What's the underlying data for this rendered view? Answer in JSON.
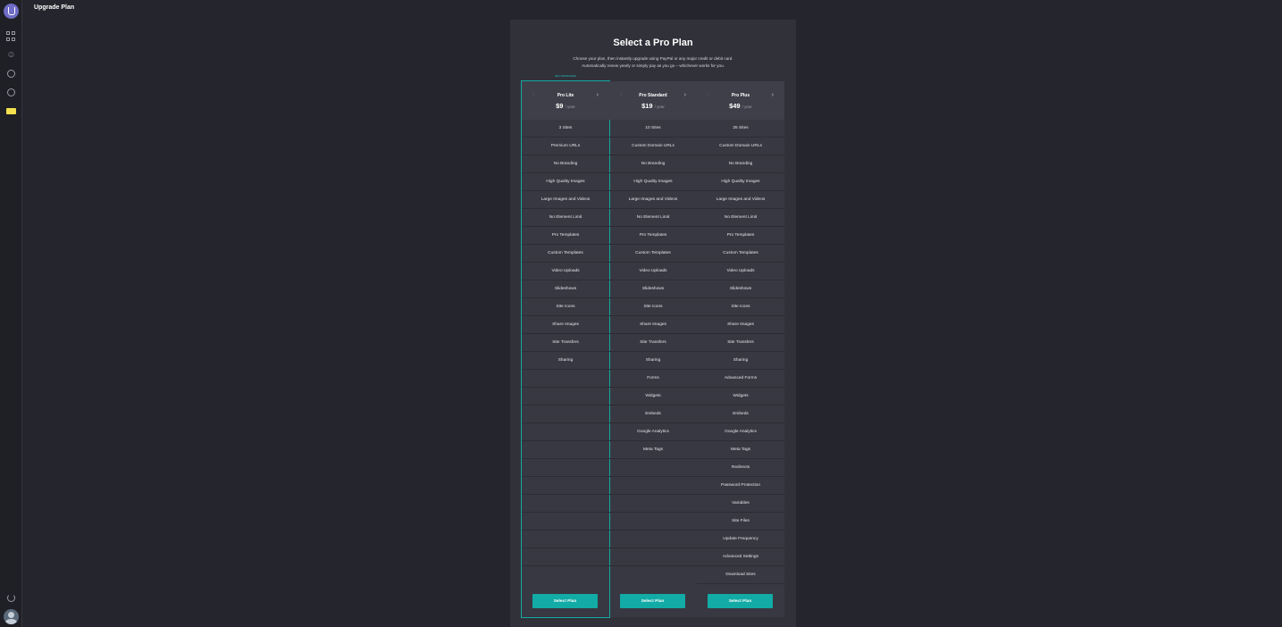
{
  "page": {
    "title": "Upgrade Plan"
  },
  "panel": {
    "title": "Select a Pro Plan",
    "subtitle_1": "Choose your plan, then instantly upgrade using PayPal or any major credit or debit card.",
    "subtitle_2": "Automatically renew yearly or simply pay as you go – whichever works for you.",
    "highlight_note": "RECOMMENDED"
  },
  "plans": [
    {
      "name": "Pro Lite",
      "price": "$9",
      "period": "/ year",
      "button": "Select Plan",
      "features": [
        "3 Sites",
        "Premium URLs",
        "No Branding",
        "High Quality Images",
        "Large Images and Videos",
        "No Element Limit",
        "Pro Templates",
        "Custom Templates",
        "Video Uploads",
        "Slideshows",
        "Site Icons",
        "Share Images",
        "Site Transfers",
        "Sharing",
        "",
        "",
        "",
        "",
        "",
        "",
        "",
        "",
        "",
        "",
        ""
      ]
    },
    {
      "name": "Pro Standard",
      "price": "$19",
      "period": "/ year",
      "button": "Select Plan",
      "features": [
        "10 Sites",
        "Custom Domain URLs",
        "No Branding",
        "High Quality Images",
        "Large Images and Videos",
        "No Element Limit",
        "Pro Templates",
        "Custom Templates",
        "Video Uploads",
        "Slideshows",
        "Site Icons",
        "Share Images",
        "Site Transfers",
        "Sharing",
        "Forms",
        "Widgets",
        "Embeds",
        "Google Analytics",
        "Meta Tags",
        "",
        "",
        "",
        "",
        "",
        ""
      ]
    },
    {
      "name": "Pro Plus",
      "price": "$49",
      "period": "/ year",
      "button": "Select Plan",
      "features": [
        "25 Sites",
        "Custom Domain URLs",
        "No Branding",
        "High Quality Images",
        "Large Images and Videos",
        "No Element Limit",
        "Pro Templates",
        "Custom Templates",
        "Video Uploads",
        "Slideshows",
        "Site Icons",
        "Share Images",
        "Site Transfers",
        "Sharing",
        "Advanced Forms",
        "Widgets",
        "Embeds",
        "Google Analytics",
        "Meta Tags",
        "Redirects",
        "Password Protection",
        "Variables",
        "Site Files",
        "Update Frequency",
        "Advanced Settings",
        "Download Sites"
      ]
    }
  ],
  "icons": [
    "logo-icon",
    "grid-icon",
    "users-icon",
    "bell-icon",
    "help-icon",
    "pro-badge-icon",
    "power-icon",
    "avatar"
  ],
  "colors": {
    "accent": "#12aba5",
    "background": "#25252d",
    "panel": "#31313a",
    "badge": "#f2e14c"
  }
}
